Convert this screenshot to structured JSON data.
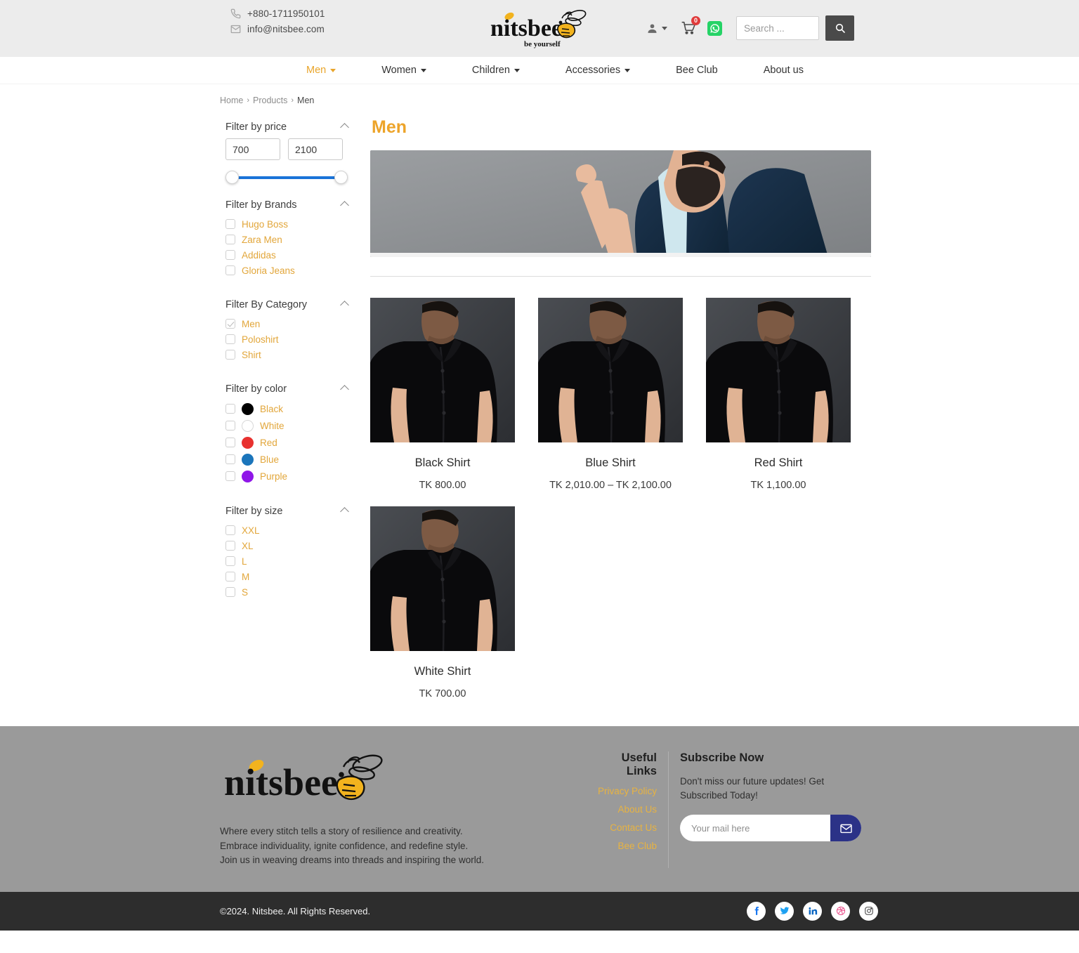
{
  "topbar": {
    "phone": "+880-1711950101",
    "email": "info@nitsbee.com",
    "logo_text": "nitsbee",
    "logo_tagline": "be yourself",
    "cart_count": "0",
    "search_placeholder": "Search ..."
  },
  "nav": {
    "items": [
      {
        "label": "Men",
        "has_caret": true,
        "active": true
      },
      {
        "label": "Women",
        "has_caret": true,
        "active": false
      },
      {
        "label": "Children",
        "has_caret": true,
        "active": false
      },
      {
        "label": "Accessories",
        "has_caret": true,
        "active": false
      },
      {
        "label": "Bee Club",
        "has_caret": false,
        "active": false
      },
      {
        "label": "About us",
        "has_caret": false,
        "active": false
      }
    ]
  },
  "breadcrumb": {
    "home": "Home",
    "products": "Products",
    "current": "Men",
    "sep": "›"
  },
  "sidebar": {
    "price": {
      "title": "Filter by price",
      "min_value": "700",
      "max_value": "2100"
    },
    "brands": {
      "title": "Filter by Brands",
      "items": [
        {
          "label": "Hugo Boss",
          "checked": false
        },
        {
          "label": "Zara Men",
          "checked": false
        },
        {
          "label": "Addidas",
          "checked": false
        },
        {
          "label": "Gloria Jeans",
          "checked": false
        }
      ]
    },
    "category": {
      "title": "Filter By Category",
      "items": [
        {
          "label": "Men",
          "checked": true
        },
        {
          "label": "Poloshirt",
          "checked": false
        },
        {
          "label": "Shirt",
          "checked": false
        }
      ]
    },
    "color": {
      "title": "Filter by color",
      "items": [
        {
          "label": "Black",
          "checked": false,
          "hex": "#000000"
        },
        {
          "label": "White",
          "checked": false,
          "hex": "#ffffff"
        },
        {
          "label": "Red",
          "checked": false,
          "hex": "#e8312f"
        },
        {
          "label": "Blue",
          "checked": false,
          "hex": "#1b75bb"
        },
        {
          "label": "Purple",
          "checked": false,
          "hex": "#8f16e8"
        }
      ]
    },
    "size": {
      "title": "Filter by size",
      "items": [
        {
          "label": "XXL",
          "checked": false
        },
        {
          "label": "XL",
          "checked": false
        },
        {
          "label": "L",
          "checked": false
        },
        {
          "label": "M",
          "checked": false
        },
        {
          "label": "S",
          "checked": false
        }
      ]
    }
  },
  "main": {
    "title": "Men",
    "products": [
      {
        "name": "Black Shirt",
        "price": "TK  800.00"
      },
      {
        "name": "Blue Shirt",
        "price": "TK  2,010.00 – TK  2,100.00"
      },
      {
        "name": "Red Shirt",
        "price": "TK  1,100.00"
      },
      {
        "name": "White Shirt",
        "price": "TK  700.00"
      }
    ]
  },
  "footer": {
    "logo_text": "nitsbee",
    "description_line1": "Where every stitch tells a story of resilience and creativity.",
    "description_line2": "Embrace individuality, ignite confidence, and redefine style.",
    "description_line3": "Join us in weaving dreams into threads and inspiring the world.",
    "useful_links_title": "Useful Links",
    "links": [
      {
        "label": "Privacy Policy"
      },
      {
        "label": "About Us"
      },
      {
        "label": "Contact Us"
      },
      {
        "label": "Bee Club"
      }
    ],
    "subscribe_title": "Subscribe Now",
    "subscribe_text": "Don't miss our future updates! Get Subscribed Today!",
    "mail_placeholder": "Your mail here",
    "copyright": "©2024. Nitsbee. All Rights Reserved.",
    "socials": [
      {
        "name": "facebook"
      },
      {
        "name": "twitter"
      },
      {
        "name": "linkedin"
      },
      {
        "name": "dribbble"
      },
      {
        "name": "instagram"
      }
    ]
  },
  "colors": {
    "accent": "#e9a52b",
    "slider": "#1a73d8",
    "badge": "#e03b3b",
    "subscribe_btn": "#2b3287",
    "footer_bg": "#9a9a9a",
    "bottombar_bg": "#2d2d2d"
  }
}
